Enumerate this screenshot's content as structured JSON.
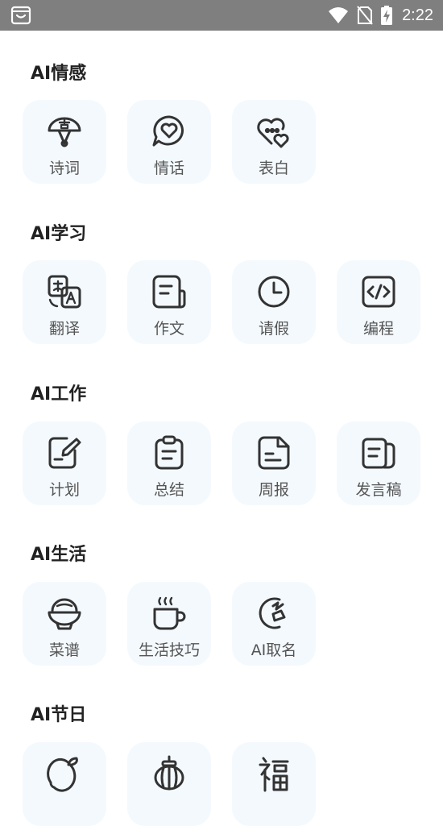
{
  "status_bar": {
    "time": "2:22"
  },
  "sections": [
    {
      "title": "AI情感",
      "items": [
        {
          "label": "诗词",
          "icon": "fan-icon"
        },
        {
          "label": "情话",
          "icon": "heart-chat-icon"
        },
        {
          "label": "表白",
          "icon": "hearts-icon"
        }
      ]
    },
    {
      "title": "AI学习",
      "items": [
        {
          "label": "翻译",
          "icon": "translate-icon"
        },
        {
          "label": "作文",
          "icon": "essay-icon"
        },
        {
          "label": "请假",
          "icon": "clock-icon"
        },
        {
          "label": "编程",
          "icon": "code-icon"
        }
      ]
    },
    {
      "title": "AI工作",
      "items": [
        {
          "label": "计划",
          "icon": "edit-note-icon"
        },
        {
          "label": "总结",
          "icon": "clipboard-icon"
        },
        {
          "label": "周报",
          "icon": "document-icon"
        },
        {
          "label": "发言稿",
          "icon": "notes-icon"
        }
      ]
    },
    {
      "title": "AI生活",
      "items": [
        {
          "label": "菜谱",
          "icon": "bowl-icon"
        },
        {
          "label": "生活技巧",
          "icon": "cup-icon"
        },
        {
          "label": "AI取名",
          "icon": "name-seal-icon"
        }
      ]
    },
    {
      "title": "AI节日",
      "items": [
        {
          "label": "",
          "icon": "mango-icon"
        },
        {
          "label": "",
          "icon": "lantern-icon"
        },
        {
          "label": "",
          "icon": "fu-icon"
        }
      ]
    }
  ]
}
